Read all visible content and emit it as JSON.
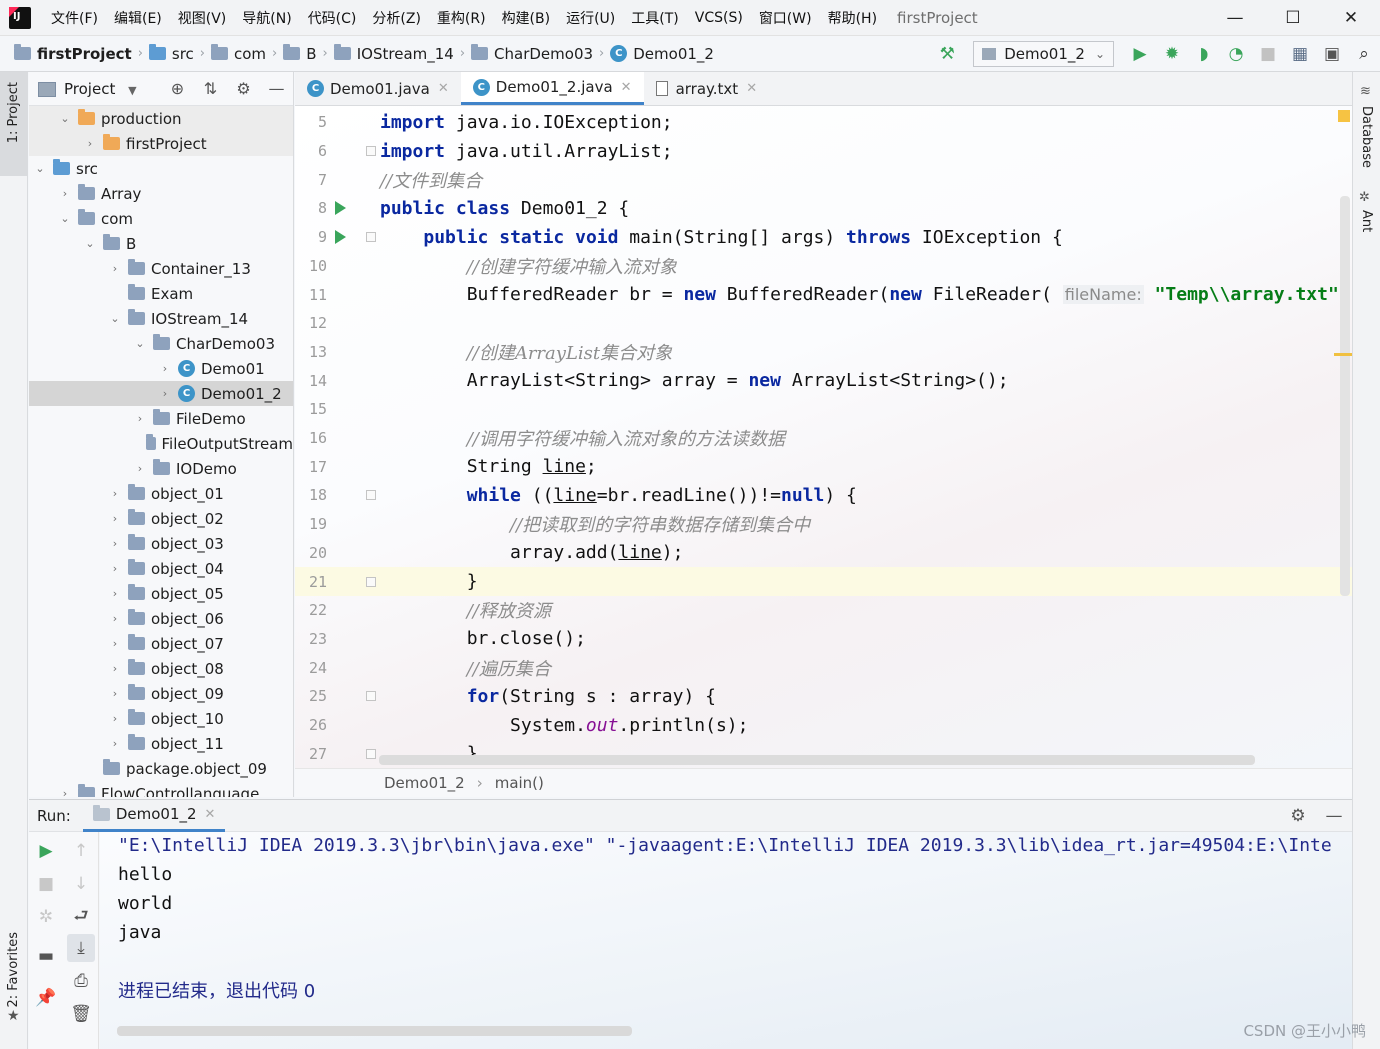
{
  "menu": {
    "items": [
      "文件(F)",
      "编辑(E)",
      "视图(V)",
      "导航(N)",
      "代码(C)",
      "分析(Z)",
      "重构(R)",
      "构建(B)",
      "运行(U)",
      "工具(T)",
      "VCS(S)",
      "窗口(W)",
      "帮助(H)"
    ],
    "window_title": "firstProject",
    "controls": [
      "—",
      "☐",
      "✕"
    ]
  },
  "navbar": {
    "crumbs": [
      "firstProject",
      "src",
      "com",
      "B",
      "IOStream_14",
      "CharDemo03",
      "Demo01_2"
    ],
    "run_config": "Demo01_2"
  },
  "side_tabs": {
    "left_top": "1: Project",
    "left_bottom": "2: Favorites",
    "right_top": "Database",
    "right_second": "Ant"
  },
  "project_panel": {
    "title": "Project",
    "tree": [
      {
        "label": "production",
        "depth": 1,
        "arrow": "⌄",
        "icon": "orange"
      },
      {
        "label": "firstProject",
        "depth": 2,
        "arrow": "›",
        "icon": "orange"
      },
      {
        "label": "src",
        "depth": 0,
        "arrow": "⌄",
        "icon": "blue"
      },
      {
        "label": "Array",
        "depth": 1,
        "arrow": "›",
        "icon": "pkg"
      },
      {
        "label": "com",
        "depth": 1,
        "arrow": "⌄",
        "icon": "pkg"
      },
      {
        "label": "B",
        "depth": 2,
        "arrow": "⌄",
        "icon": "pkg"
      },
      {
        "label": "Container_13",
        "depth": 3,
        "arrow": "›",
        "icon": "pkg"
      },
      {
        "label": "Exam",
        "depth": 3,
        "arrow": "",
        "icon": "pkg"
      },
      {
        "label": "IOStream_14",
        "depth": 3,
        "arrow": "⌄",
        "icon": "pkg"
      },
      {
        "label": "CharDemo03",
        "depth": 4,
        "arrow": "⌄",
        "icon": "pkg"
      },
      {
        "label": "Demo01",
        "depth": 5,
        "arrow": "›",
        "icon": "class"
      },
      {
        "label": "Demo01_2",
        "depth": 5,
        "arrow": "›",
        "icon": "class"
      },
      {
        "label": "FileDemo",
        "depth": 4,
        "arrow": "›",
        "icon": "pkg"
      },
      {
        "label": "FileOutputStream",
        "depth": 4,
        "arrow": "",
        "icon": "pkg"
      },
      {
        "label": "IODemo",
        "depth": 4,
        "arrow": "›",
        "icon": "pkg"
      },
      {
        "label": "object_01",
        "depth": 3,
        "arrow": "›",
        "icon": "pkg"
      },
      {
        "label": "object_02",
        "depth": 3,
        "arrow": "›",
        "icon": "pkg"
      },
      {
        "label": "object_03",
        "depth": 3,
        "arrow": "›",
        "icon": "pkg"
      },
      {
        "label": "object_04",
        "depth": 3,
        "arrow": "›",
        "icon": "pkg"
      },
      {
        "label": "object_05",
        "depth": 3,
        "arrow": "›",
        "icon": "pkg"
      },
      {
        "label": "object_06",
        "depth": 3,
        "arrow": "›",
        "icon": "pkg"
      },
      {
        "label": "object_07",
        "depth": 3,
        "arrow": "›",
        "icon": "pkg"
      },
      {
        "label": "object_08",
        "depth": 3,
        "arrow": "›",
        "icon": "pkg"
      },
      {
        "label": "object_09",
        "depth": 3,
        "arrow": "›",
        "icon": "pkg"
      },
      {
        "label": "object_10",
        "depth": 3,
        "arrow": "›",
        "icon": "pkg"
      },
      {
        "label": "object_11",
        "depth": 3,
        "arrow": "›",
        "icon": "pkg"
      },
      {
        "label": "package.object_09",
        "depth": 2,
        "arrow": "",
        "icon": "pkg"
      },
      {
        "label": "FlowControllanguage",
        "depth": 1,
        "arrow": "›",
        "icon": "pkg"
      }
    ]
  },
  "editor": {
    "tabs": [
      {
        "label": "Demo01.java",
        "close": "✕"
      },
      {
        "label": "Demo01_2.java",
        "close": "✕"
      },
      {
        "label": "array.txt",
        "close": "✕"
      }
    ],
    "lines": [
      {
        "no": "5",
        "code": "import java.io.IOException;"
      },
      {
        "no": "6",
        "code": "import java.util.ArrayList;"
      },
      {
        "no": "7",
        "code": "//文件到集合"
      },
      {
        "no": "8",
        "code": "public class Demo01_2 {"
      },
      {
        "no": "9",
        "code": "    public static void main(String[] args) throws IOException {"
      },
      {
        "no": "10",
        "code": "        //创建字符缓冲输入流对象"
      },
      {
        "no": "11",
        "code": "        BufferedReader br = new BufferedReader(new FileReader( fileName: \"Temp\\\\array.txt\""
      },
      {
        "no": "12",
        "code": ""
      },
      {
        "no": "13",
        "code": "        //创建ArrayList集合对象"
      },
      {
        "no": "14",
        "code": "        ArrayList<String> array = new ArrayList<String>();"
      },
      {
        "no": "15",
        "code": ""
      },
      {
        "no": "16",
        "code": "        //调用字符缓冲输入流对象的方法读数据"
      },
      {
        "no": "17",
        "code": "        String line;"
      },
      {
        "no": "18",
        "code": "        while ((line=br.readLine())!=null) {"
      },
      {
        "no": "19",
        "code": "            //把读取到的字符串数据存储到集合中"
      },
      {
        "no": "20",
        "code": "            array.add(line);"
      },
      {
        "no": "21",
        "code": "        }"
      },
      {
        "no": "22",
        "code": "        //释放资源"
      },
      {
        "no": "23",
        "code": "        br.close();"
      },
      {
        "no": "24",
        "code": "        //遍历集合"
      },
      {
        "no": "25",
        "code": "        for(String s : array) {"
      },
      {
        "no": "26",
        "code": "            System.out.println(s);"
      },
      {
        "no": "27",
        "code": "        }"
      }
    ],
    "breadcrumb": [
      "Demo01_2",
      "main()"
    ]
  },
  "run_panel": {
    "label": "Run:",
    "tab": "Demo01_2",
    "console": [
      "\"E:\\IntelliJ IDEA 2019.3.3\\jbr\\bin\\java.exe\" \"-javaagent:E:\\IntelliJ IDEA 2019.3.3\\lib\\idea_rt.jar=49504:E:\\Inte",
      "hello",
      "world",
      "java",
      "",
      "进程已结束，退出代码 0"
    ]
  },
  "watermark": "CSDN @王小小鸭",
  "colors": {
    "keyword": "#0a28a0",
    "comment": "#8c8c8c",
    "string": "#067d17",
    "run_green": "#3aa55b",
    "accent": "#4083c9"
  }
}
